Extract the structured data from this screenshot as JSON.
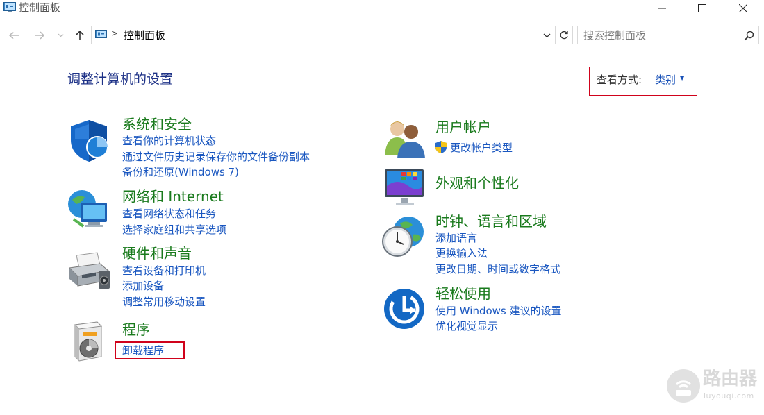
{
  "window": {
    "title": "控制面板",
    "icon": "control-panel-icon"
  },
  "address": {
    "path": "控制面板",
    "separator": ">"
  },
  "search": {
    "placeholder": "搜索控制面板"
  },
  "header": {
    "title": "调整计算机的设置",
    "view_label": "查看方式:",
    "view_value": "类别"
  },
  "categories_left": [
    {
      "title": "系统和安全",
      "icon": "shield-icon",
      "links": [
        "查看你的计算机状态",
        "通过文件历史记录保存你的文件备份副本",
        "备份和还原(Windows 7)"
      ]
    },
    {
      "title": "网络和 Internet",
      "icon": "network-icon",
      "links": [
        "查看网络状态和任务",
        "选择家庭组和共享选项"
      ]
    },
    {
      "title": "硬件和声音",
      "icon": "printer-icon",
      "links": [
        "查看设备和打印机",
        "添加设备",
        "调整常用移动设置"
      ]
    },
    {
      "title": "程序",
      "icon": "programs-icon",
      "links": [
        "卸载程序"
      ]
    }
  ],
  "categories_right": [
    {
      "title": "用户帐户",
      "icon": "users-icon",
      "links": [
        "更改帐户类型"
      ]
    },
    {
      "title": "外观和个性化",
      "icon": "appearance-icon",
      "links": []
    },
    {
      "title": "时钟、语言和区域",
      "icon": "clock-globe-icon",
      "links": [
        "添加语言",
        "更换输入法",
        "更改日期、时间或数字格式"
      ]
    },
    {
      "title": "轻松使用",
      "icon": "ease-of-access-icon",
      "links": [
        "使用 Windows 建议的设置",
        "优化视觉显示"
      ]
    }
  ],
  "watermark": {
    "text": "路由器",
    "sub": "luyouqi.com"
  },
  "colors": {
    "category_title": "#197a1c",
    "link": "#1a57c0",
    "heading": "#1e3287",
    "highlight": "#d0021b"
  }
}
